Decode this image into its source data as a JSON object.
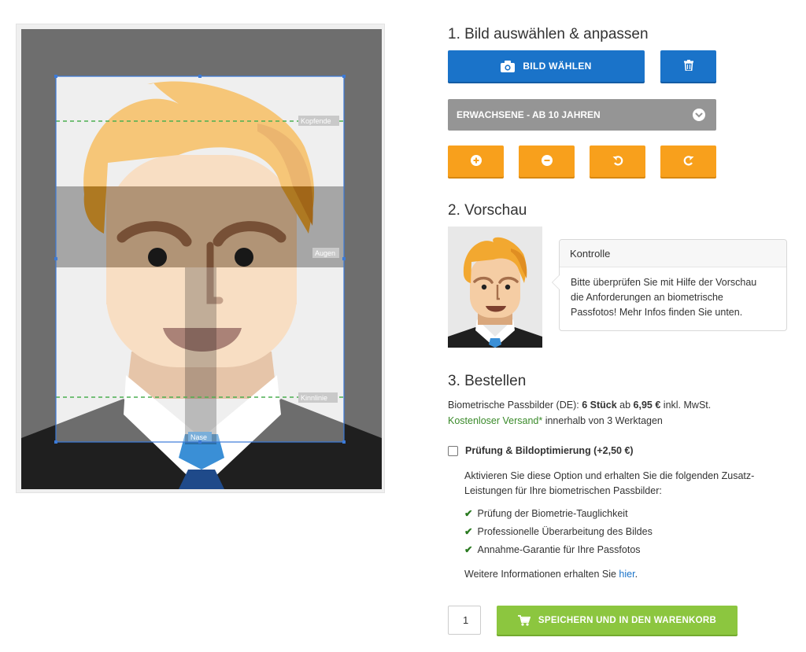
{
  "editor": {
    "guides": {
      "top": "Kopfende",
      "eyes": "Augen",
      "chin": "Kinnlinie",
      "nose": "Nase"
    }
  },
  "step1": {
    "title": "1. Bild auswählen & anpassen",
    "choose_button": "BILD WÄHLEN",
    "choose_icon": "camera-icon",
    "delete_icon": "trash-icon",
    "age_select": "ERWACHSENE - AB 10 JAHREN",
    "tools": [
      "zoom-in-icon",
      "zoom-out-icon",
      "rotate-left-icon",
      "rotate-right-icon"
    ]
  },
  "step2": {
    "title": "2. Vorschau",
    "popover_title": "Kontrolle",
    "popover_lines": [
      "Bitte überprüfen Sie mit Hilfe der Vorschau",
      "die Anforderungen an biometrische",
      "Passfotos! Mehr Infos finden Sie unten."
    ]
  },
  "step3": {
    "title": "3. Bestellen",
    "product_prefix": "Biometrische Passbilder (DE):",
    "product_count": "6 Stück",
    "product_from": "ab",
    "product_price": "6,95 €",
    "product_suffix": "inkl. MwSt.",
    "shipping_highlight": "Kostenloser Versand*",
    "shipping_rest": "innerhalb von 3 Werktagen",
    "option_label": "Prüfung & Bildoptimierung (+2,50 €)",
    "option_checked": false,
    "option_desc_1": "Aktivieren Sie diese Option und erhalten Sie die folgenden Zusatz-",
    "option_desc_2": "Leistungen für Ihre biometrischen Passbilder:",
    "benefits": [
      "Prüfung der Biometrie-Tauglichkeit",
      "Professionelle Überarbeitung des Bildes",
      "Annahme-Garantie für Ihre Passfotos"
    ],
    "more_info_prefix": "Weitere Informationen erhalten Sie",
    "more_info_link": "hier",
    "more_info_suffix": ".",
    "quantity": "1",
    "cart_button": "SPEICHERN UND IN DEN WARENKORB",
    "cart_icon": "cart-icon"
  },
  "colors": {
    "primary": "#1a73c9",
    "tool": "#f8a01c",
    "cart": "#8cc63f",
    "select": "#959595",
    "guide": "#4caf50"
  }
}
